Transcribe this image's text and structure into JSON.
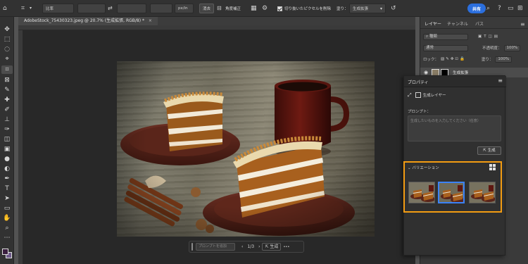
{
  "optbar": {
    "ratio_label": "比率",
    "unit_label": "px/in",
    "clear_button": "消去",
    "straighten_button": "角度補正",
    "delete_cropped_label": "切り抜いたピクセルを削除",
    "fill_label": "塗り：",
    "fill_value": "生成拡張",
    "share_button": "共有"
  },
  "document": {
    "tab_title": "AdobeStock_75430323.jpeg @ 20.7% (生成拡張, RGB/8) *"
  },
  "layers_panel": {
    "tabs": [
      "レイヤー",
      "チャンネル",
      "パス"
    ],
    "kind_filter": "種類",
    "blend_mode": "通常",
    "opacity_label": "不透明度：",
    "opacity_value": "100%",
    "lock_label": "ロック：",
    "fill_label": "塗り：",
    "fill_value": "100%",
    "layer_name": "生成拡張"
  },
  "properties": {
    "title": "プロパティ",
    "layer_type": "生成レイヤー",
    "prompt_label": "プロンプト：",
    "prompt_placeholder": "生成したいものを入力してください（任意）",
    "generate_button": "生成",
    "variations_label": "バリエーション"
  },
  "taskbar": {
    "prompt_placeholder": "プロンプトを追加",
    "page_indicator": "1/3",
    "generate_button": "生成",
    "more": "•••"
  },
  "colors": {
    "accent_orange": "#f39c12",
    "selection_blue": "#3b82f6",
    "share_blue": "#2b6fde"
  }
}
